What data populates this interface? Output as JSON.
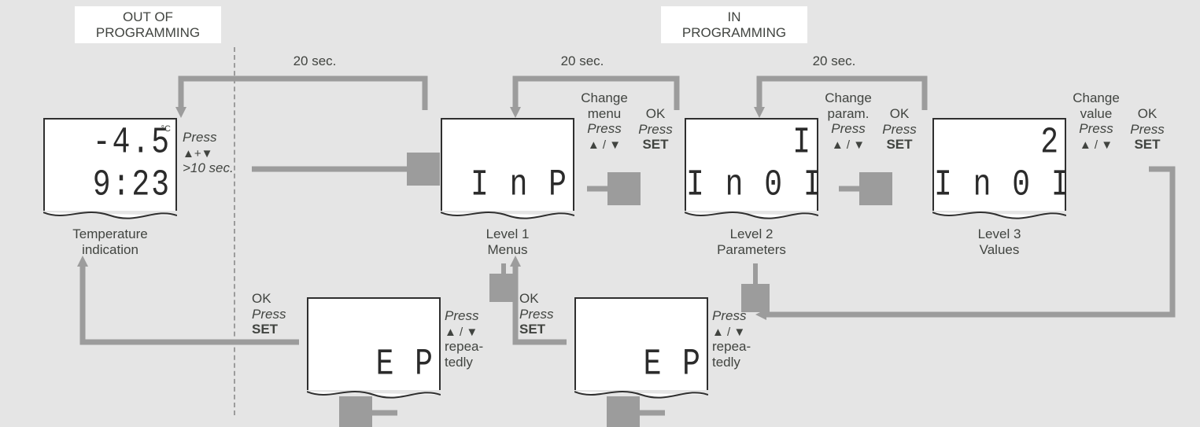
{
  "headers": {
    "out": "OUT OF\nPROGRAMMING",
    "in": "IN\nPROGRAMMING"
  },
  "timeouts": {
    "t1": "20 sec.",
    "t2": "20 sec.",
    "t3": "20 sec."
  },
  "displays": {
    "temp": {
      "top": "-4.5",
      "unit": "°C",
      "bot": "9:23",
      "caption": "Temperature\nindication"
    },
    "menus": {
      "top": "",
      "bot": "I n P",
      "caption": "Level 1\nMenus"
    },
    "params": {
      "top": "I",
      "bot": "I n 0 I",
      "caption": "Level 2\nParameters"
    },
    "values": {
      "top": "2",
      "bot": "I n 0 I",
      "caption": "Level 3\nValues"
    },
    "ep1": {
      "top": "",
      "bot": "E P"
    },
    "ep2": {
      "top": "",
      "bot": "E P"
    }
  },
  "labels": {
    "enter": {
      "line1": "Press",
      "line2": "▲+▼",
      "line3": ">10 sec."
    },
    "changeMenu": {
      "title": "Change\nmenu",
      "press": "Press",
      "keys": "▲ / ▼"
    },
    "okMenu": {
      "title": "OK",
      "press": "Press",
      "keys": "SET"
    },
    "changeParam": {
      "title": "Change\nparam.",
      "press": "Press",
      "keys": "▲ / ▼"
    },
    "okParam": {
      "title": "OK",
      "press": "Press",
      "keys": "SET"
    },
    "changeValue": {
      "title": "Change\nvalue",
      "press": "Press",
      "keys": "▲ / ▼"
    },
    "okValue": {
      "title": "OK",
      "press": "Press",
      "keys": "SET"
    },
    "ep1Left": {
      "title": "OK",
      "press": "Press",
      "keys": "SET"
    },
    "ep1Right": {
      "press": "Press",
      "keys": "▲ / ▼",
      "note": "repea-\ntedly"
    },
    "ep2Left": {
      "title": "OK",
      "press": "Press",
      "keys": "SET"
    },
    "ep2Right": {
      "press": "Press",
      "keys": "▲ / ▼",
      "note": "repea-\ntedly"
    }
  }
}
